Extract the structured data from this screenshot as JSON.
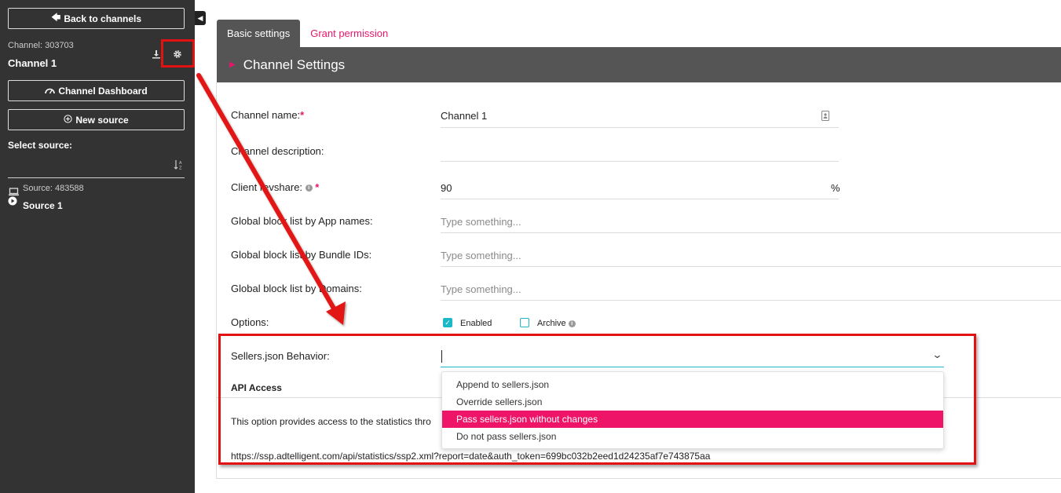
{
  "sidebar": {
    "back_label": "Back to channels",
    "channel_id": "Channel: 303703",
    "channel_name": "Channel 1",
    "dashboard_label": "Channel Dashboard",
    "new_source_label": "New source",
    "select_source_label": "Select source:",
    "source_id": "Source: 483588",
    "source_name": "Source 1",
    "icons": [
      "arrow-left-icon",
      "download-icon",
      "gear-icon",
      "dashboard-icon",
      "plus-circle-icon",
      "sort-icon",
      "monitor-icon",
      "play-icon",
      "collapse-icon"
    ]
  },
  "tabs": [
    {
      "label": "Basic settings",
      "active": true
    },
    {
      "label": "Grant permission",
      "active": false
    }
  ],
  "panel": {
    "title": "Channel Settings"
  },
  "form": {
    "channel_name_label": "Channel name:",
    "channel_name_value": "Channel 1",
    "channel_description_label": "Channel description:",
    "client_revshare_label": "Client revshare:",
    "client_revshare_value": "90",
    "client_revshare_unit": "%",
    "block_app_label": "Global block list by App names:",
    "block_bundle_label": "Global block list by Bundle IDs:",
    "block_domains_label": "Global block list by Domains:",
    "placeholder": "Type something...",
    "required_mark": "*",
    "options_label": "Options:",
    "enabled_label": "Enabled",
    "enabled_checked": true,
    "archive_label": "Archive",
    "archive_checked": false,
    "sellers_label": "Sellers.json Behavior:",
    "sellers_options": [
      "Append to sellers.json",
      "Override sellers.json",
      "Pass sellers.json without changes",
      "Do not pass sellers.json"
    ],
    "sellers_highlighted": "Pass sellers.json without changes"
  },
  "api": {
    "title": "API Access",
    "description": "This option provides access to the statistics thro",
    "url": "https://ssp.adtelligent.com/api/statistics/ssp2.xml?report=date&auth_token=699bc032b2eed1d24235af7e743875aa"
  },
  "colors": {
    "sidebar_bg": "#333333",
    "accent_pink": "#e4166b",
    "highlight": "#ee1569",
    "teal": "#1bb8c8",
    "annotation_red": "#e31212",
    "header_bg": "#555555"
  }
}
